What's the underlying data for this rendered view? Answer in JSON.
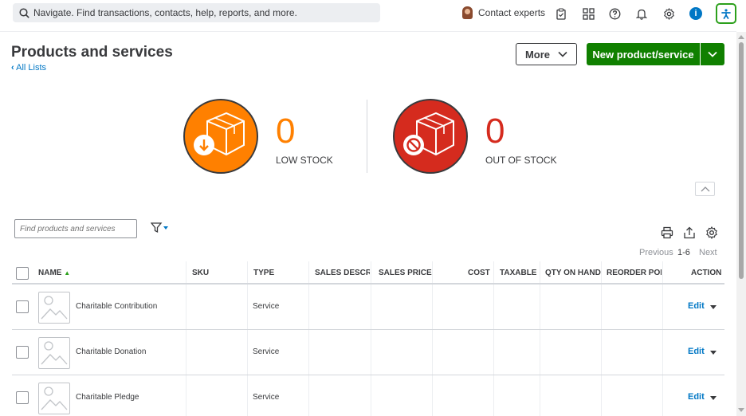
{
  "topbar": {
    "search_placeholder": "Navigate. Find transactions, contacts, help, reports, and more.",
    "contact_label": "Contact experts",
    "info_badge": "i"
  },
  "header": {
    "title": "Products and services",
    "back_link": "All Lists",
    "more_label": "More",
    "new_label": "New product/service"
  },
  "stock": {
    "low": {
      "count": "0",
      "label": "LOW STOCK",
      "color": "#ff8000"
    },
    "out": {
      "count": "0",
      "label": "OUT OF STOCK",
      "color": "#d52b1e"
    }
  },
  "toolbar": {
    "filter_placeholder": "Find products and services"
  },
  "pager": {
    "previous": "Previous",
    "range": "1-6",
    "next": "Next"
  },
  "table": {
    "columns": [
      "NAME",
      "SKU",
      "TYPE",
      "SALES DESCRII",
      "SALES PRICE",
      "COST",
      "TAXABLE",
      "QTY ON HAND",
      "REORDER POIN",
      "ACTION"
    ],
    "rows": [
      {
        "name": "Charitable Contribution",
        "type": "Service",
        "action": "Edit"
      },
      {
        "name": "Charitable Donation",
        "type": "Service",
        "action": "Edit"
      },
      {
        "name": "Charitable Pledge",
        "type": "Service",
        "action": "Edit"
      }
    ]
  },
  "colors": {
    "primary_green": "#108000",
    "link_blue": "#0077c5"
  }
}
